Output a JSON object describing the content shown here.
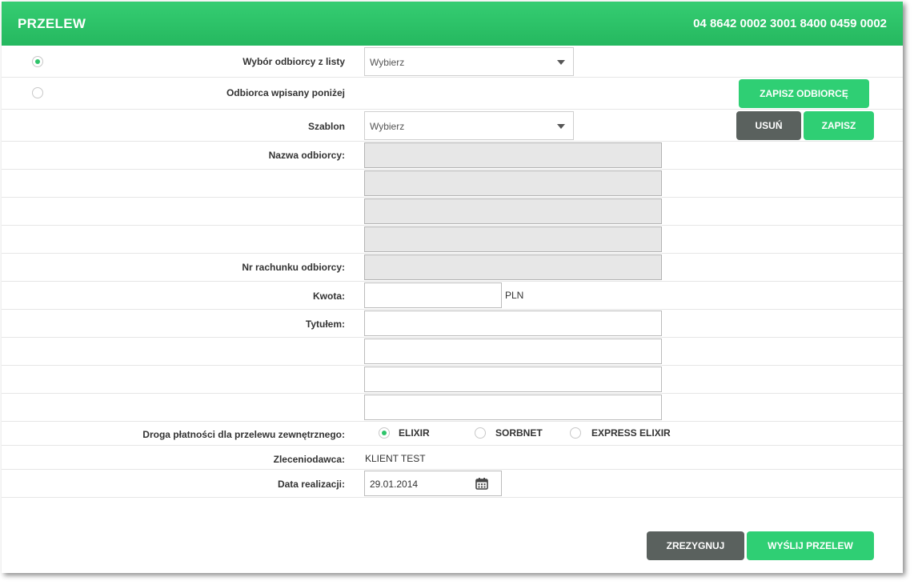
{
  "header": {
    "title": "PRZELEW",
    "account": "04 8642 0002 3001 8400 0459 0002"
  },
  "recipient": {
    "from_list_label": "Wybór odbiorcy z listy",
    "from_list_selected": true,
    "from_list_value": "Wybierz",
    "manual_label": "Odbiorca wpisany poniżej",
    "save_recipient_button": "ZAPISZ ODBIORCĘ"
  },
  "template": {
    "label": "Szablon",
    "value": "Wybierz",
    "delete_button": "USUŃ",
    "save_button": "ZAPISZ"
  },
  "recipient_name": {
    "label": "Nazwa odbiorcy:",
    "lines": [
      "",
      "",
      "",
      ""
    ]
  },
  "recipient_account": {
    "label": "Nr rachunku odbiorcy:",
    "value": ""
  },
  "amount": {
    "label": "Kwota:",
    "value": "",
    "currency": "PLN"
  },
  "title": {
    "label": "Tytułem:",
    "lines": [
      "",
      "",
      "",
      ""
    ]
  },
  "payment_route": {
    "label": "Droga płatności dla przelewu zewnętrznego:",
    "options": [
      {
        "label": "ELIXIR",
        "selected": true
      },
      {
        "label": "SORBNET",
        "selected": false
      },
      {
        "label": "EXPRESS ELIXIR",
        "selected": false
      }
    ]
  },
  "orderer": {
    "label": "Zleceniodawca:",
    "value": "KLIENT TEST"
  },
  "execution_date": {
    "label": "Data realizacji:",
    "value": "29.01.2014"
  },
  "footer": {
    "cancel_button": "ZREZYGNUJ",
    "send_button": "WYŚLIJ PRZELEW"
  },
  "colors": {
    "accent": "#2fcf74",
    "dark_button": "#5a615e"
  },
  "icons": {
    "calendar": "calendar-icon",
    "dropdown": "chevron-down-icon"
  }
}
